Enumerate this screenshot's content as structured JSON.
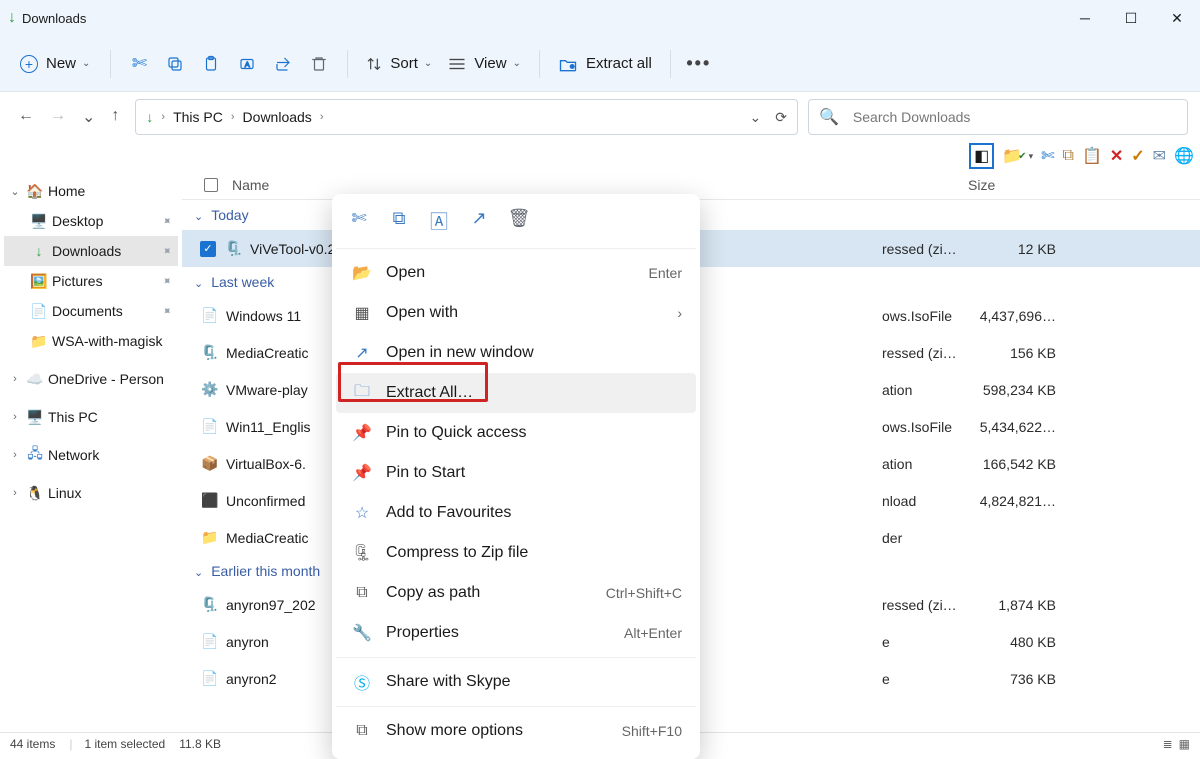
{
  "window": {
    "title": "Downloads"
  },
  "toolbar": {
    "new": "New",
    "sort": "Sort",
    "view": "View",
    "extract_all": "Extract all"
  },
  "address": {
    "crumbs": [
      "This PC",
      "Downloads"
    ]
  },
  "search": {
    "placeholder": "Search Downloads"
  },
  "sidebar": {
    "home": "Home",
    "desktop": "Desktop",
    "downloads": "Downloads",
    "pictures": "Pictures",
    "documents": "Documents",
    "wsa": "WSA-with-magisk",
    "onedrive": "OneDrive - Person",
    "thispc": "This PC",
    "network": "Network",
    "linux": "Linux"
  },
  "columns": {
    "name": "Name",
    "size": "Size"
  },
  "groups": {
    "today": "Today",
    "lastweek": "Last week",
    "earlier": "Earlier this month"
  },
  "files": {
    "today": [
      {
        "name": "ViVeTool-v0.2",
        "type": "ressed (zi…",
        "size": "12 KB"
      }
    ],
    "lastweek": [
      {
        "name": "Windows 11 ",
        "type": "ows.IsoFile",
        "size": "4,437,696…"
      },
      {
        "name": "MediaCreatic",
        "type": "ressed (zi…",
        "size": "156 KB"
      },
      {
        "name": "VMware-play",
        "type": "ation",
        "size": "598,234 KB"
      },
      {
        "name": "Win11_Englis",
        "type": "ows.IsoFile",
        "size": "5,434,622…"
      },
      {
        "name": "VirtualBox-6.",
        "type": "ation",
        "size": "166,542 KB"
      },
      {
        "name": "Unconfirmed",
        "type": "nload",
        "size": "4,824,821…"
      },
      {
        "name": "MediaCreatic",
        "type": "der",
        "size": ""
      }
    ],
    "earlier": [
      {
        "name": "anyron97_202",
        "type": "ressed (zi…",
        "size": "1,874 KB"
      },
      {
        "name": "anyron",
        "type": "e",
        "size": "480 KB"
      },
      {
        "name": "anyron2",
        "type": "e",
        "size": "736 KB"
      }
    ]
  },
  "context_menu": {
    "open": "Open",
    "open_sh": "Enter",
    "open_with": "Open with",
    "open_new_window": "Open in new window",
    "extract_all": "Extract All…",
    "pin_quick": "Pin to Quick access",
    "pin_start": "Pin to Start",
    "favourites": "Add to Favourites",
    "compress": "Compress to Zip file",
    "copy_path": "Copy as path",
    "copy_path_sh": "Ctrl+Shift+C",
    "properties": "Properties",
    "properties_sh": "Alt+Enter",
    "share_skype": "Share with Skype",
    "show_more": "Show more options",
    "show_more_sh": "Shift+F10"
  },
  "status": {
    "items": "44 items",
    "selected": "1 item selected",
    "sel_size": "11.8 KB"
  }
}
